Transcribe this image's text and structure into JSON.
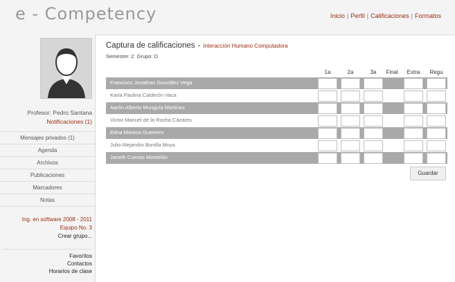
{
  "app": {
    "logo": "e - Competency"
  },
  "topnav": {
    "items": [
      "Inicio",
      "Perfil",
      "Calificaciones",
      "Formatos"
    ]
  },
  "sidebar": {
    "professor": "Profesor: Pedro Santana",
    "notifications": "Notificaciones (1)",
    "menu": [
      "Mensajes privados (1)",
      "Agenda",
      "Archivos",
      "Publicaciones",
      "Marcadores",
      "Notas"
    ],
    "course": "Ing. en software 2008 - 2011",
    "team": "Equipo No. 3",
    "create_group": "Crear grupo...",
    "links": [
      "Favoritos",
      "Contactos",
      "Horarios de clase"
    ]
  },
  "main": {
    "title": "Captura de calificaciones",
    "dash": "-",
    "subject": "Interacción Humano Computadora",
    "semester_label": "Semestre:",
    "semester_value": "2",
    "group_label": "Grupo:",
    "group_value": "D",
    "columns": [
      "1a",
      "2a",
      "3a",
      "Final",
      "Extra",
      "Regu"
    ],
    "students": [
      "Francisco Jonathan González Vega",
      "Karla Paulina Calderón Vaca",
      "Aarón Alberto Munguía Martínez",
      "Victor Manuel de la Rocha Cázares",
      "Edna Moreno Guerrero",
      "Julio Alejandro Bonilla Moya",
      "Janeth Cuevas Montelón"
    ],
    "save_label": "Guardar"
  }
}
